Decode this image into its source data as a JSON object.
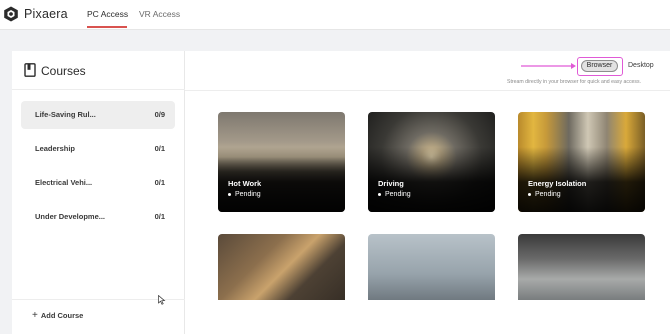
{
  "app": {
    "brand": "Pixaera",
    "tabs": [
      {
        "label": "PC Access",
        "active": true
      },
      {
        "label": "VR Access",
        "active": false
      }
    ],
    "accent_color": "#d9534f"
  },
  "sidebar": {
    "title": "Courses",
    "icon": "book-icon",
    "items": [
      {
        "label": "Life-Saving Rul...",
        "count": "0/9",
        "selected": true
      },
      {
        "label": "Leadership",
        "count": "0/1",
        "selected": false
      },
      {
        "label": "Electrical Vehi...",
        "count": "0/1",
        "selected": false
      },
      {
        "label": "Under Developme...",
        "count": "0/1",
        "selected": false
      }
    ],
    "add_label": "Add Course"
  },
  "mode_switch": {
    "browser_label": "Browser",
    "desktop_label": "Desktop",
    "note": "Stream directly in your browser for quick and easy access.",
    "highlight_color": "#e05ad6"
  },
  "cards": [
    {
      "title": "Hot Work",
      "status": "Pending"
    },
    {
      "title": "Driving",
      "status": "Pending"
    },
    {
      "title": "Energy Isolation",
      "status": "Pending"
    }
  ]
}
